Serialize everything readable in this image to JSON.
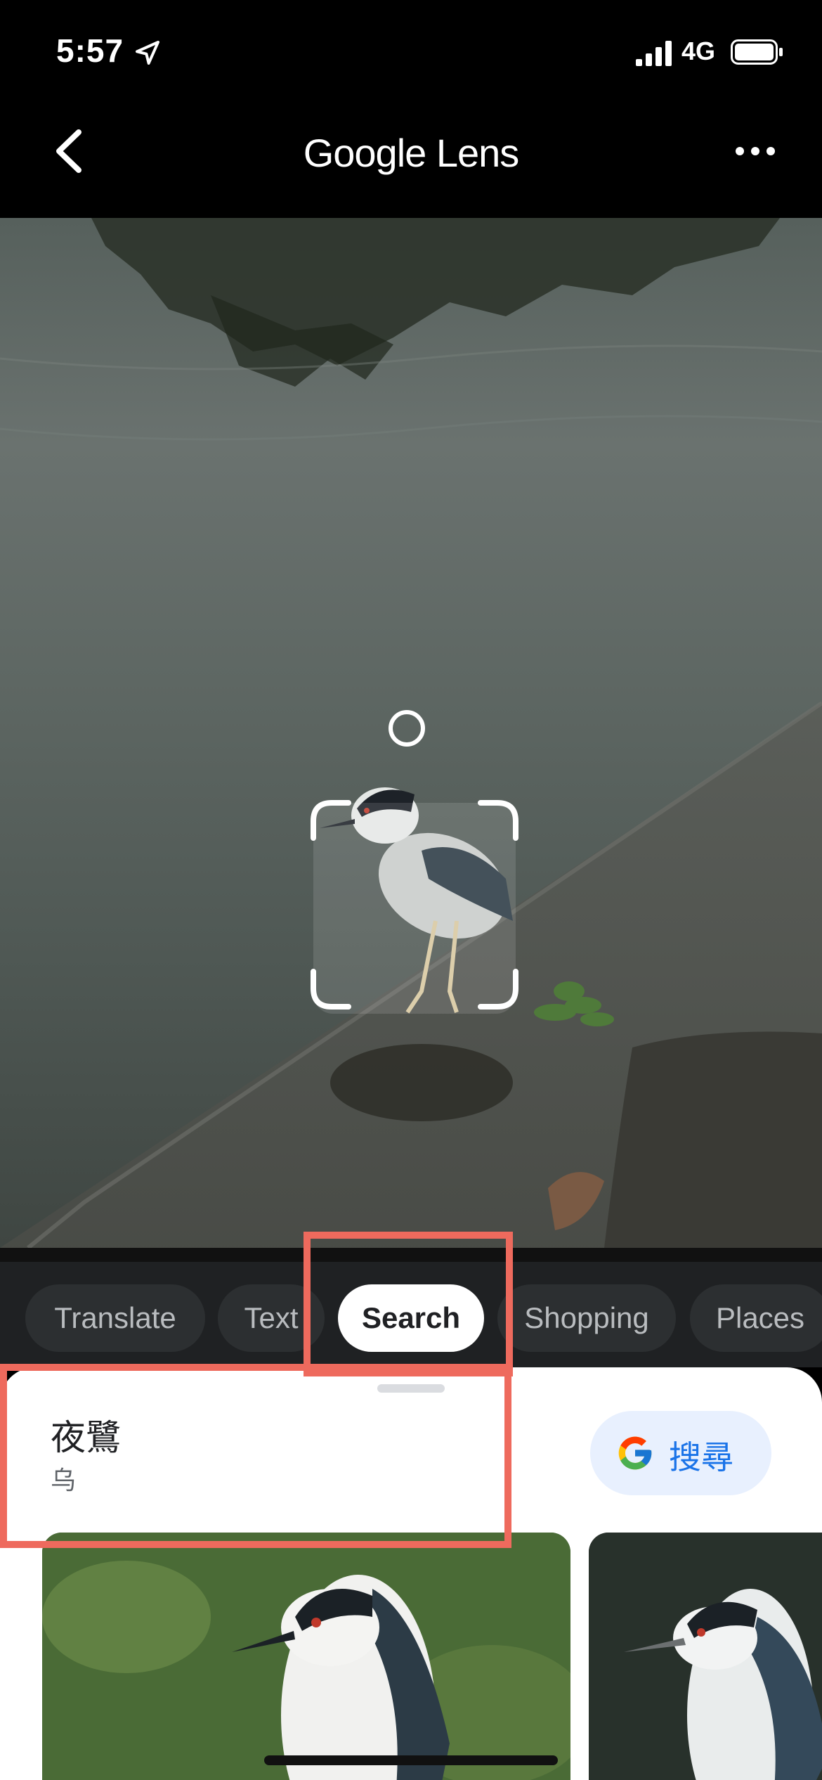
{
  "status_bar": {
    "time": "5:57",
    "network": "4G"
  },
  "header": {
    "title": "Google Lens"
  },
  "tabs": [
    {
      "label": "Translate"
    },
    {
      "label": "Text"
    },
    {
      "label": "Search"
    },
    {
      "label": "Shopping"
    },
    {
      "label": "Places"
    }
  ],
  "active_tab": "Search",
  "result": {
    "name": "夜鷺",
    "category": "乌",
    "search_button_label": "搜尋"
  },
  "icons": [
    "location-arrow-icon",
    "signal-icon",
    "battery-icon",
    "back-chevron-icon",
    "more-dots-icon",
    "scan-dot-icon",
    "google-g-icon"
  ],
  "colors": {
    "highlight": "#ee6a5d",
    "accent_blue": "#1a73e8",
    "search_chip_bg": "#e8f0fe"
  }
}
